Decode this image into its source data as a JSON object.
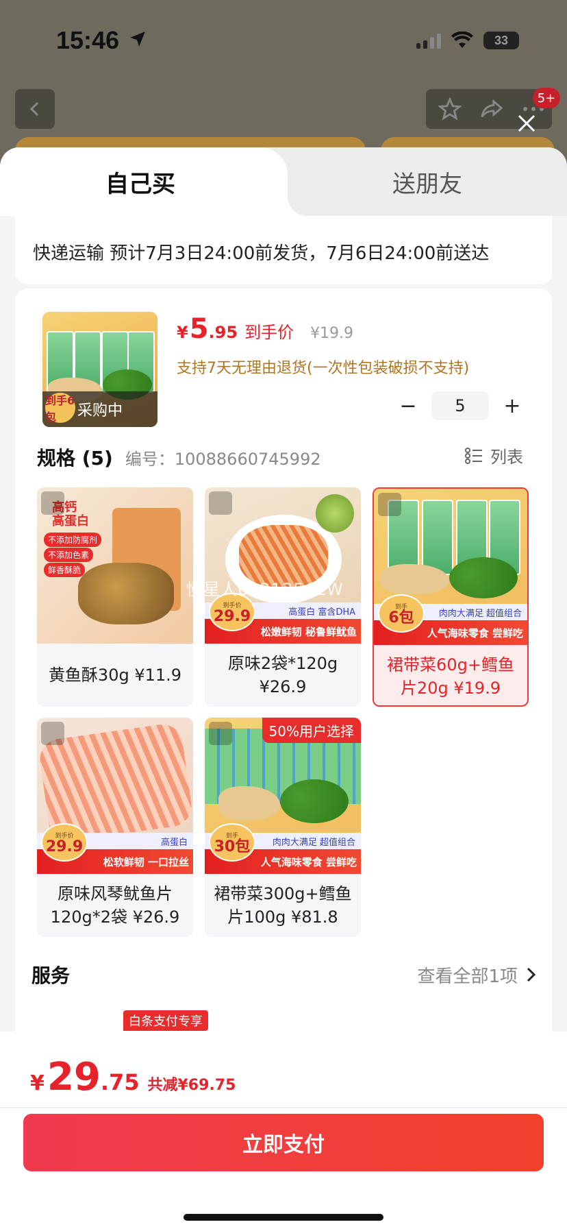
{
  "status_bar": {
    "time": "15:46",
    "battery": "33"
  },
  "background": {
    "badge": "5+"
  },
  "tabs": {
    "self_buy": "自己买",
    "gift": "送朋友"
  },
  "shipping": {
    "text": "快递运输 预计7月3日24:00前发货，7月6日24:00前送达"
  },
  "product": {
    "price_symbol": "¥",
    "price_int": "5",
    "price_dec": ".95",
    "price_tag": "到手价",
    "original_price": "¥19.9",
    "return_policy": "支持7天无理由退货(一次性包装破损不支持)",
    "thumb_overlay": "采购中",
    "thumb_badge": "到手6包",
    "quantity": "5",
    "minus": "−",
    "plus": "+"
  },
  "spec": {
    "title": "规格 (5)",
    "code_label": "编号：",
    "code": "10088660745992",
    "list_toggle": "列表",
    "items": [
      {
        "label": "黄鱼酥30g ¥11.9",
        "selected": false,
        "img_title": "高钙\n高蛋白",
        "tags": [
          "不添加防腐剂",
          "不添加色素",
          "鲜香酥脆"
        ]
      },
      {
        "label": "原味2袋*120g ¥26.9",
        "selected": false,
        "badge_price": "29.9",
        "badge_small": "到手价",
        "blue": "高蛋白 富含DHA",
        "red": "松嫩鲜韧 秘鲁鲜鱿鱼"
      },
      {
        "label": "裙带菜60g+鳕鱼片20g ¥19.9",
        "selected": true,
        "badge_price": "6包",
        "badge_small": "到手",
        "blue": "肉肉大满足 超值组合",
        "red": "人气海味零食 尝鲜吃"
      },
      {
        "label": "原味风琴鱿鱼片120g*2袋 ¥26.9",
        "selected": false,
        "badge_price": "29.9",
        "badge_small": "到手价",
        "blue": "高蛋白",
        "red": "松软鲜韧 一口拉丝"
      },
      {
        "label": "裙带菜300g+鳕鱼片100g ¥81.8",
        "selected": false,
        "promo": "50%用户选择",
        "badge_price": "30包",
        "badge_small": "到手",
        "blue": "肉肉大满足 超值组合",
        "red": "人气海味零食 尝鲜吃"
      }
    ]
  },
  "watermark": "慢星人6921354EW",
  "service": {
    "title": "服务",
    "link": "查看全部1项",
    "tag": "白条支付专享"
  },
  "footer": {
    "total_symbol": "¥",
    "total_int": "29",
    "total_dec": ".75",
    "saved": "共减¥69.75",
    "pay_button": "立即支付"
  }
}
